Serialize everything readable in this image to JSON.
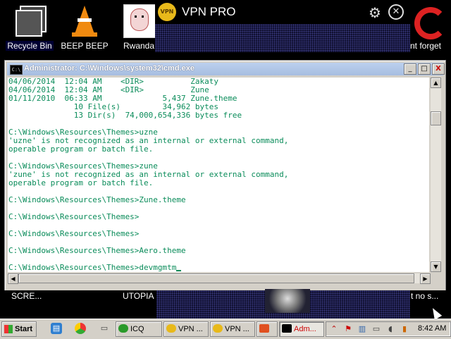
{
  "desktop": {
    "icons": [
      {
        "label": "Recycle Bin",
        "icon": "stacked-windows-icon"
      },
      {
        "label": "BEEP BEEP",
        "icon": "traffic-cone-icon"
      },
      {
        "label": "Rwanda",
        "icon": "face-icon"
      },
      {
        "label": "nt forget",
        "icon": "red-c-icon"
      }
    ],
    "bottom_labels": [
      "SCRE...",
      "UTOPIA",
      "t no s..."
    ]
  },
  "vpn": {
    "title": "VPN PRO",
    "logo_text": "VPN"
  },
  "cmd_window": {
    "title": "Administrator: C:\\Windows\\system32\\cmd.exe",
    "minimize_glyph": "_",
    "maximize_glyph": "□",
    "close_glyph": "X",
    "icon_text": "C:\\",
    "lines": [
      "04/06/2014  12:04 AM    <DIR>          Zakaty",
      "04/06/2014  12:04 AM    <DIR>          Zune",
      "01/11/2010  06:33 AM             5,437 Zune.theme",
      "              10 File(s)         34,962 bytes",
      "              13 Dir(s)  74,000,654,336 bytes free",
      "",
      "C:\\Windows\\Resources\\Themes>uzne",
      "'uzne' is not recognized as an internal or external command,",
      "operable program or batch file.",
      "",
      "C:\\Windows\\Resources\\Themes>zune",
      "'zune' is not recognized as an internal or external command,",
      "operable program or batch file.",
      "",
      "C:\\Windows\\Resources\\Themes>Zune.theme",
      "",
      "C:\\Windows\\Resources\\Themes>",
      "",
      "C:\\Windows\\Resources\\Themes>",
      "",
      "C:\\Windows\\Resources\\Themes>Aero.theme",
      "",
      "C:\\Windows\\Resources\\Themes>devmgmtm"
    ]
  },
  "taskbar": {
    "start_label": "Start",
    "buttons": [
      {
        "label": "ICQ",
        "icon": "icq-flower-icon",
        "color": "#2a9a2a"
      },
      {
        "label": "VPN ...",
        "icon": "vpn-icon",
        "color": "#e8b91a"
      },
      {
        "label": "VPN ...",
        "icon": "vpn-icon",
        "color": "#e8b91a"
      },
      {
        "label": "",
        "icon": "paint-icon",
        "color": "#e05020"
      },
      {
        "label": "Adm...",
        "icon": "cmd-icon",
        "color": "#000000"
      }
    ],
    "clock": "8:42 AM"
  },
  "colors": {
    "console_text": "#0a8c5a",
    "console_bg": "#ffffff",
    "titlebar": "#a6bde0"
  }
}
